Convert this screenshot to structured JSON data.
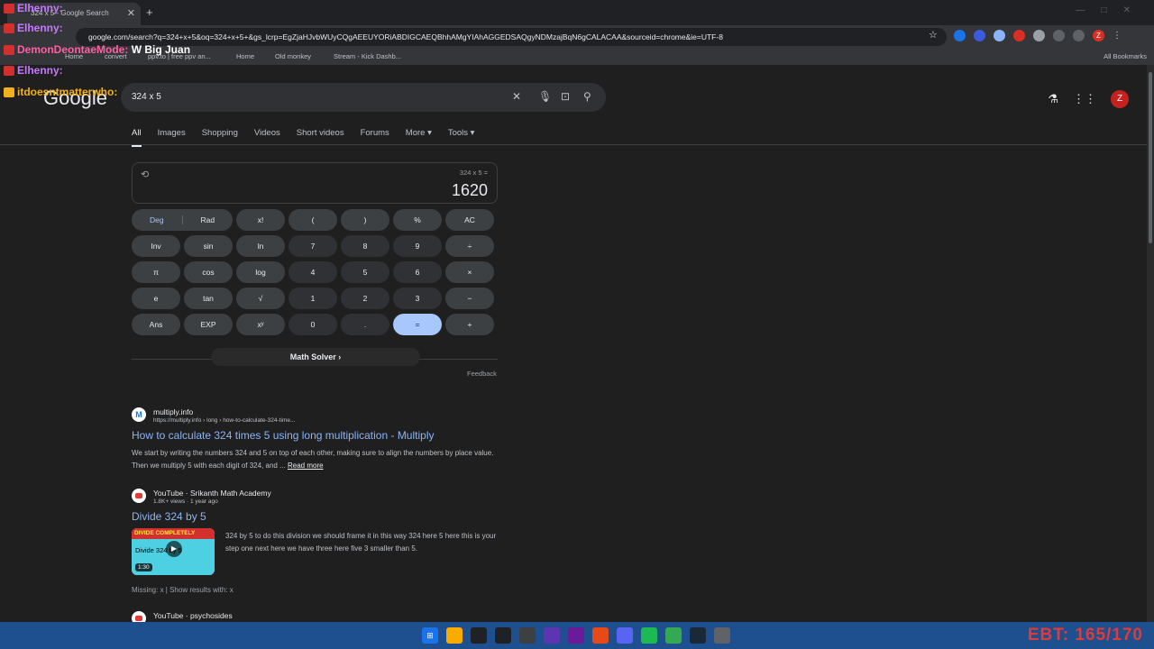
{
  "browser": {
    "tab_title": "324 x 5 - Google Search",
    "url": "google.com/search?q=324+x+5&oq=324+x+5+&gs_lcrp=EgZjaHJvbWUyCQgAEEUYORiABDIGCAEQBhhAMgYIAhAGGEDSAQgyNDMzajBqN6gCALACAA&sourceid=chrome&ie=UTF-8",
    "bookmarks": [
      "Home",
      "convert",
      "ppv.to | free ppv an...",
      "Home",
      "Old monkey",
      "Stream - Kick Dashb..."
    ],
    "all_bookmarks": "All Bookmarks",
    "profile_initial": "Z"
  },
  "google": {
    "logo": "Google",
    "search_value": "324 x 5",
    "avatar_initial": "Z",
    "tabs": [
      "All",
      "Images",
      "Shopping",
      "Videos",
      "Short videos",
      "Forums",
      "More",
      "Tools"
    ]
  },
  "calculator": {
    "expression": "324 x 5 =",
    "result": "1620",
    "deg": "Deg",
    "rad": "Rad",
    "keys": [
      [
        "x!",
        "(",
        ")",
        "%",
        "AC"
      ],
      [
        "Inv",
        "sin",
        "ln",
        "7",
        "8",
        "9",
        "÷"
      ],
      [
        "π",
        "cos",
        "log",
        "4",
        "5",
        "6",
        "×"
      ],
      [
        "e",
        "tan",
        "√",
        "1",
        "2",
        "3",
        "−"
      ],
      [
        "Ans",
        "EXP",
        "xʸ",
        "0",
        ".",
        "=",
        "+"
      ]
    ],
    "math_solver": "Math Solver",
    "feedback": "Feedback"
  },
  "results": [
    {
      "site": "multiply.info",
      "url": "https://multiply.info › long › how-to-calculate-324-time...",
      "title": "How to calculate 324 times 5 using long multiplication - Multiply",
      "snippet": "We start by writing the numbers 324 and 5 on top of each other, making sure to align the numbers by place value. Then we multiply 5 with each digit of 324, and ...",
      "read_more": "Read more"
    },
    {
      "site": "YouTube · Srikanth Math Academy",
      "meta": "1.8K+ views · 1 year ago",
      "title": "Divide 324 by 5",
      "snippet": "324 by 5 to do this division we should frame it in this way 324 here 5 here this is your step one next here we have three here five 3 smaller than 5.",
      "thumb_top": "DIVIDE    COMPLETELY",
      "thumb_body": "Divide 324 by 5",
      "duration": "1:30",
      "missing": "Missing: x | Show results with: x"
    },
    {
      "site": "YouTube · psychosides"
    }
  ],
  "chat": [
    {
      "user": "Elhenny:",
      "color": "#c678ff",
      "text": ""
    },
    {
      "user": "Elhenny:",
      "color": "#c678ff",
      "text": ""
    },
    {
      "user": "DemonDeontaeMode:",
      "color": "#ff5fa2",
      "text": "W Big Juan"
    },
    {
      "user": "Elhenny:",
      "color": "#c678ff",
      "text": ""
    },
    {
      "user": "itdoesntmatterwho:",
      "color": "#f2b01e",
      "text": ""
    }
  ],
  "overlay": {
    "ebt": "EBT: 165/170"
  }
}
